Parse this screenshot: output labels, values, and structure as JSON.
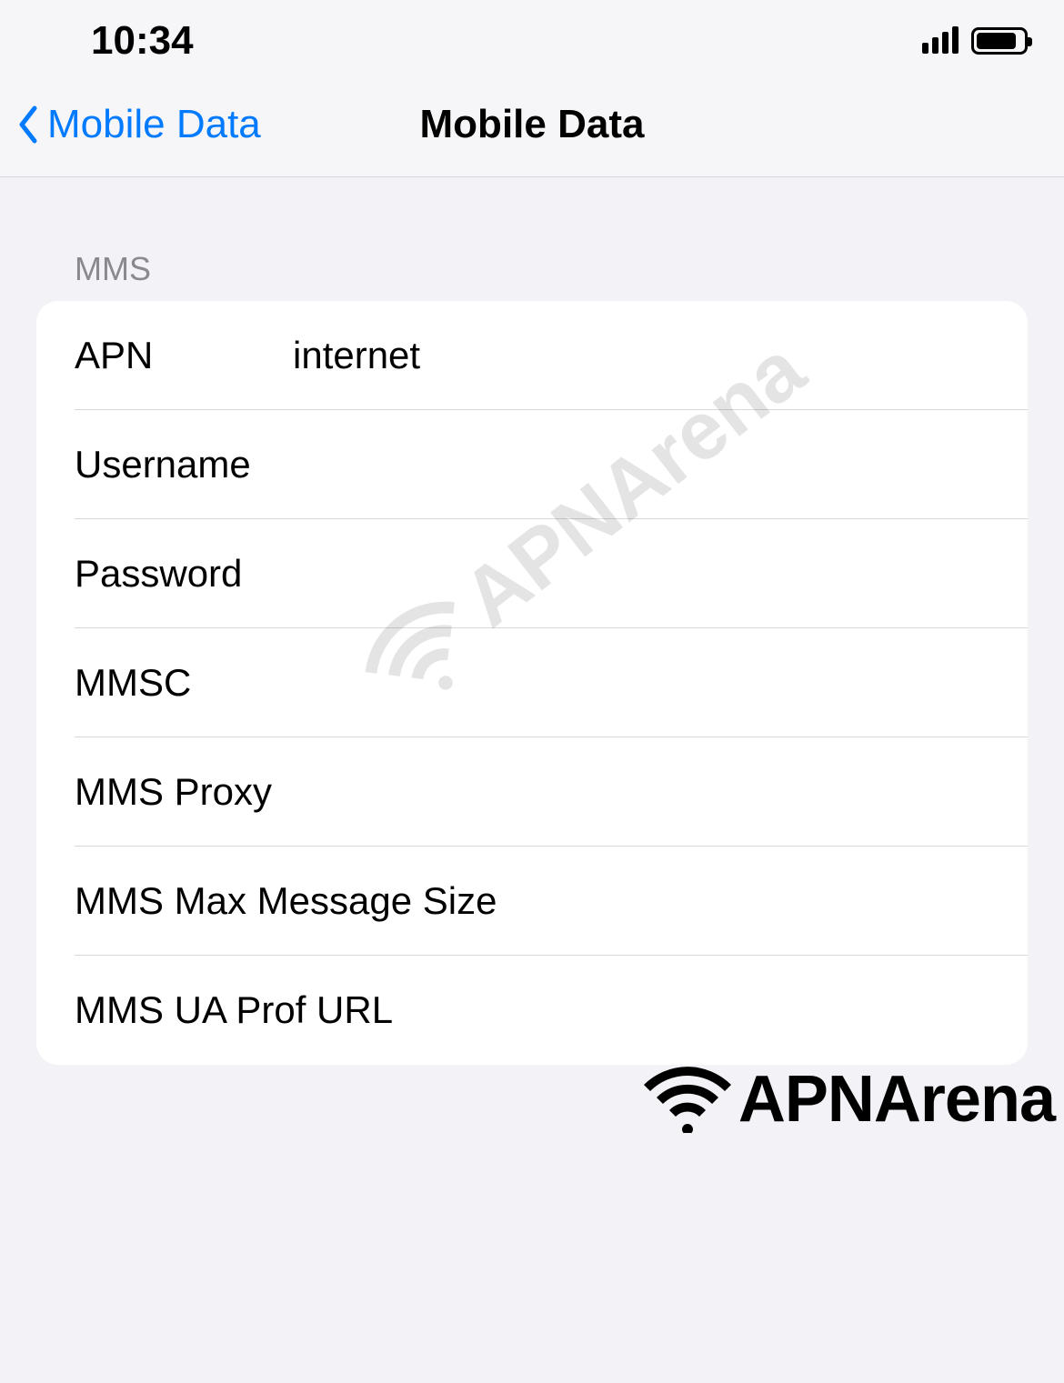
{
  "status": {
    "time": "10:34"
  },
  "nav": {
    "back_label": "Mobile Data",
    "title": "Mobile Data"
  },
  "section": {
    "header": "MMS",
    "rows": [
      {
        "label": "APN",
        "value": "internet"
      },
      {
        "label": "Username",
        "value": ""
      },
      {
        "label": "Password",
        "value": ""
      },
      {
        "label": "MMSC",
        "value": ""
      },
      {
        "label": "MMS Proxy",
        "value": ""
      },
      {
        "label": "MMS Max Message Size",
        "value": ""
      },
      {
        "label": "MMS UA Prof URL",
        "value": ""
      }
    ]
  },
  "watermark": {
    "text": "APNArena"
  },
  "logo": {
    "text": "APNArena"
  }
}
